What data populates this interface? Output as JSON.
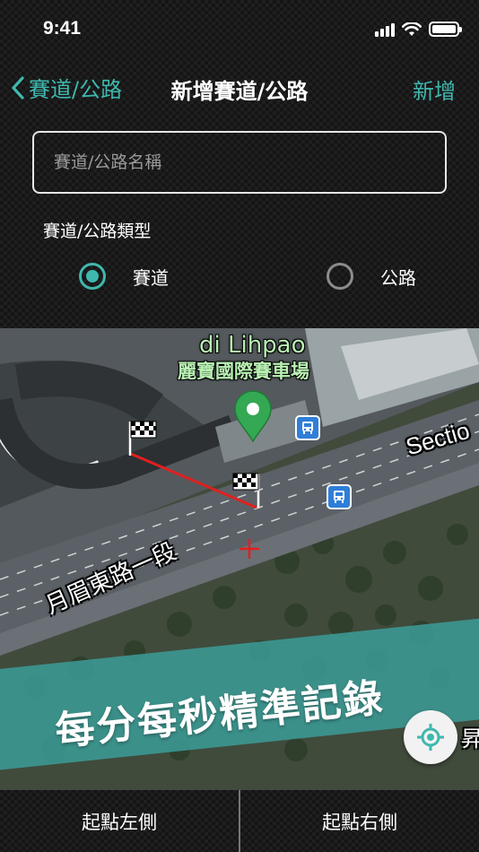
{
  "status_bar": {
    "time": "9:41",
    "icons": [
      "signal-icon",
      "wifi-icon",
      "battery-icon"
    ]
  },
  "nav": {
    "back_label": "賽道/公路",
    "title": "新增賽道/公路",
    "action_label": "新增"
  },
  "form": {
    "name_placeholder": "賽道/公路名稱",
    "name_value": "",
    "type_label": "賽道/公路類型",
    "options": [
      {
        "label": "賽道",
        "selected": true
      },
      {
        "label": "公路",
        "selected": false
      }
    ]
  },
  "map": {
    "venue_name_en": "di Lihpao",
    "venue_name_zh": "麗寶國際賽車場",
    "road_name": "月眉東路一段",
    "section_label": "Sectio",
    "edge_label": "昇",
    "banner": "每分每秒精準記錄"
  },
  "bottom_bar": {
    "left_label": "起點左側",
    "right_label": "起點右側"
  },
  "colors": {
    "accent": "#3fb8ae",
    "background": "#151515",
    "start_line": "#e02020"
  }
}
